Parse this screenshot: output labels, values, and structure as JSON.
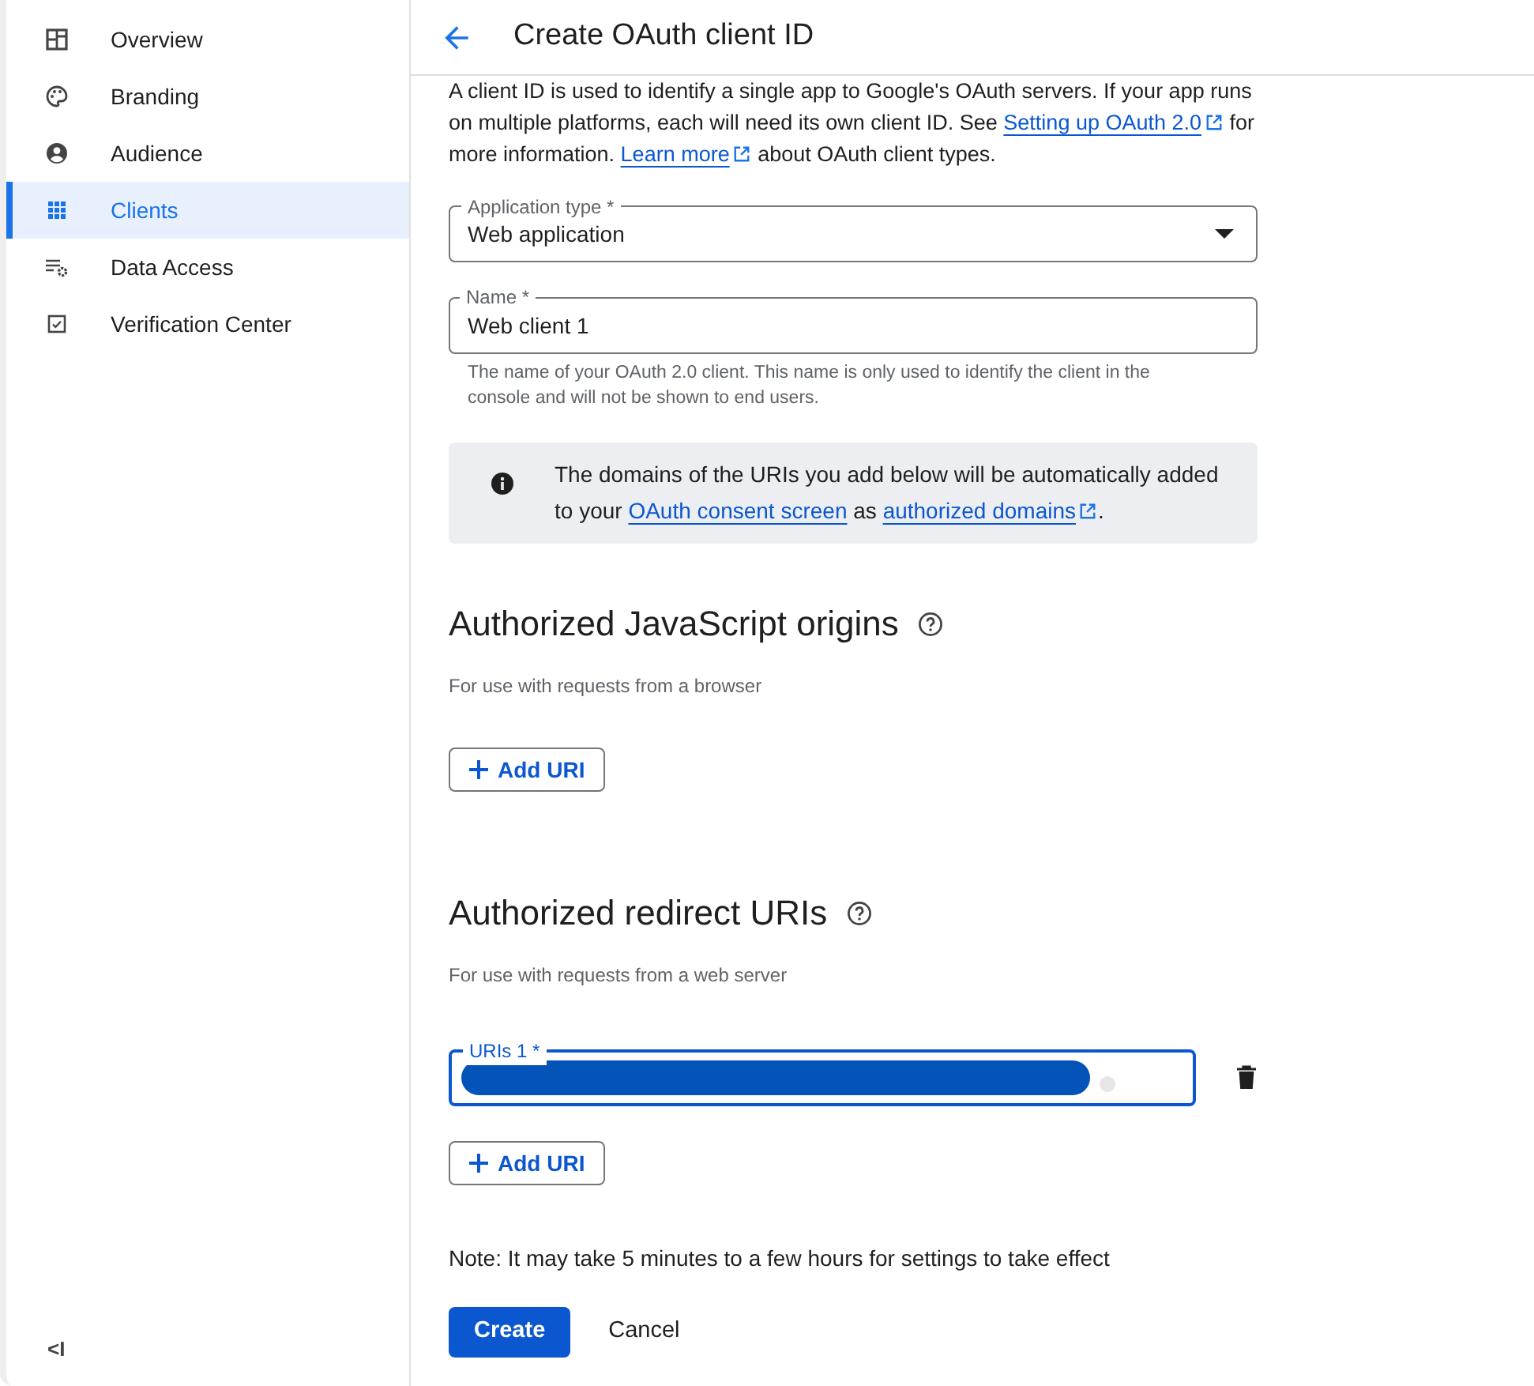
{
  "sidebar": {
    "items": [
      {
        "label": "Overview",
        "selected": false
      },
      {
        "label": "Branding",
        "selected": false
      },
      {
        "label": "Audience",
        "selected": false
      },
      {
        "label": "Clients",
        "selected": true
      },
      {
        "label": "Data Access",
        "selected": false
      },
      {
        "label": "Verification Center",
        "selected": false
      }
    ],
    "collapse_label": "<I"
  },
  "header": {
    "title": "Create OAuth client ID"
  },
  "intro": [
    {
      "kind": "text",
      "text": "A client ID is used to identify a single app to Google's OAuth servers. If your app runs on multiple platforms, each will need its own client ID. See "
    },
    {
      "kind": "link",
      "text": "Setting up OAuth 2.0",
      "external": true
    },
    {
      "kind": "text",
      "text": " for more information. "
    },
    {
      "kind": "link",
      "text": "Learn more",
      "external": true
    },
    {
      "kind": "text",
      "text": " about OAuth client types."
    }
  ],
  "application_type": {
    "label": "Application type *",
    "value": "Web application"
  },
  "name_field": {
    "label": "Name *",
    "value": "Web client 1",
    "hint": "The name of your OAuth 2.0 client. This name is only used to identify the client in the console and will not be shown to end users."
  },
  "info_box": [
    {
      "kind": "text",
      "text": "The domains of the URIs you add below will be automatically added to your "
    },
    {
      "kind": "link",
      "text": "OAuth consent screen",
      "external": false
    },
    {
      "kind": "text",
      "text": " as "
    },
    {
      "kind": "link",
      "text": "authorized domains",
      "external": true
    },
    {
      "kind": "text",
      "text": "."
    }
  ],
  "sections": [
    {
      "title": "Authorized JavaScript origins",
      "subtitle": "For use with requests from a browser",
      "add_label": "Add URI"
    },
    {
      "title": "Authorized redirect URIs",
      "subtitle": "For use with requests from a web server",
      "uris": [
        {
          "label": "URIs 1 *",
          "focused": true,
          "redacted": true
        }
      ],
      "add_label": "Add URI"
    }
  ],
  "note": "Note: It may take 5 minutes to a few hours for settings to take effect",
  "buttons": {
    "primary": "Create",
    "secondary": "Cancel"
  }
}
